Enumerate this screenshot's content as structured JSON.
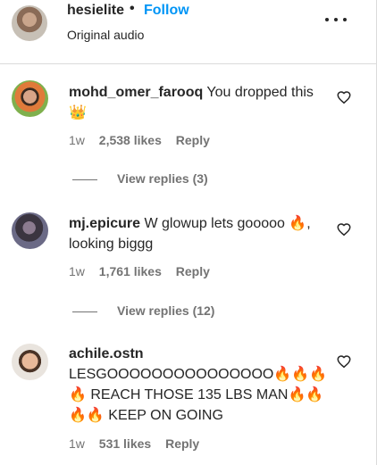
{
  "post": {
    "author": "hesielite",
    "separator": "•",
    "follow_label": "Follow",
    "audio_label": "Original audio"
  },
  "comments": [
    {
      "username": "mohd_omer_farooq",
      "text": "You dropped this 👑",
      "time": "1w",
      "likes": "2,538 likes",
      "reply_label": "Reply",
      "view_replies": "View replies (3)"
    },
    {
      "username": "mj.epicure",
      "text": "W glowup lets gooooo 🔥, looking biggg",
      "time": "1w",
      "likes": "1,761 likes",
      "reply_label": "Reply",
      "view_replies": "View replies (12)"
    },
    {
      "username": "achile.ostn",
      "text": "LESGOOOOOOOOOOOOOOO🔥🔥🔥🔥 REACH THOSE 135 LBS MAN🔥🔥🔥🔥 KEEP ON GOING",
      "time": "1w",
      "likes": "531 likes",
      "reply_label": "Reply"
    }
  ],
  "icons": {
    "more": "more-options-icon",
    "like": "heart-outline-icon"
  },
  "colors": {
    "follow_blue": "#0095f6",
    "text_primary": "#262626",
    "text_secondary": "#737373",
    "divider": "#dbdbdb"
  }
}
